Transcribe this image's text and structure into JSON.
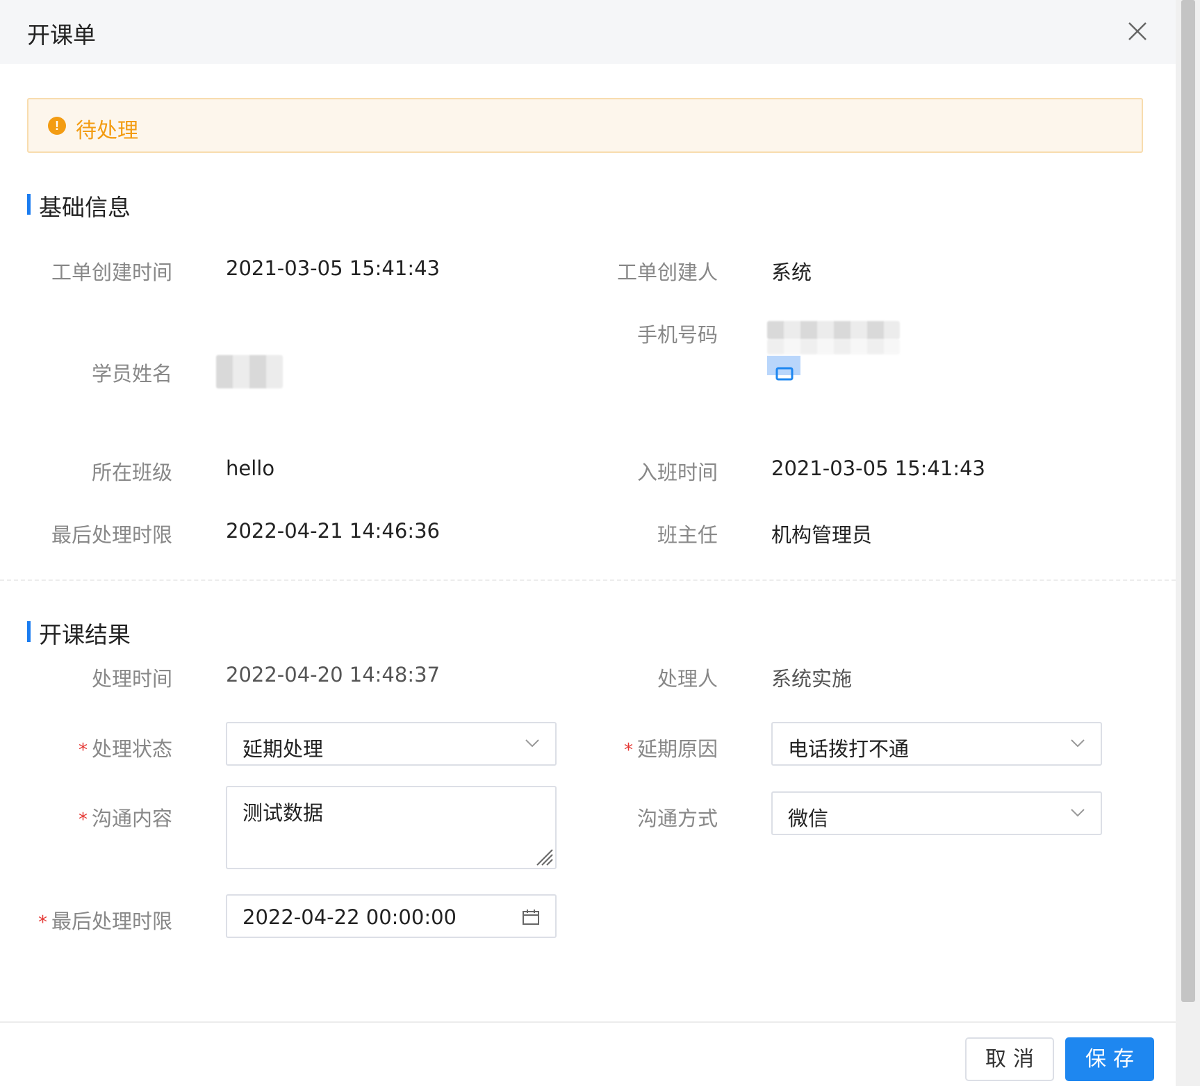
{
  "dialog": {
    "title": "开课单"
  },
  "status": {
    "text": "待处理",
    "icon": "exclamation-circle-icon",
    "color": "#f39c12"
  },
  "basic_info": {
    "section_title": "基础信息",
    "created_time_label": "工单创建时间",
    "created_time_value": "2021-03-05 15:41:43",
    "creator_label": "工单创建人",
    "creator_value": "系统",
    "student_name_label": "学员姓名",
    "phone_label": "手机号码",
    "class_label": "所在班级",
    "class_value": "hello",
    "join_time_label": "入班时间",
    "join_time_value": "2021-03-05 15:41:43",
    "deadline_label": "最后处理时限",
    "deadline_value": "2022-04-21 14:46:36",
    "head_teacher_label": "班主任",
    "head_teacher_value": "机构管理员"
  },
  "result": {
    "section_title": "开课结果",
    "process_time_label": "处理时间",
    "process_time_value": "2022-04-20 14:48:37",
    "processor_label": "处理人",
    "processor_value": "系统实施",
    "status_label": "处理状态",
    "status_value": "延期处理",
    "delay_reason_label": "延期原因",
    "delay_reason_value": "电话拨打不通",
    "content_label": "沟通内容",
    "content_value": "测试数据",
    "method_label": "沟通方式",
    "method_value": "微信",
    "deadline_label": "最后处理时限",
    "deadline_value": "2022-04-22 00:00:00",
    "required_mark": "*"
  },
  "footer": {
    "cancel_label": "取消",
    "save_label": "保存"
  },
  "colors": {
    "accent": "#1e87f0",
    "warning": "#f39c12",
    "required": "#e53935"
  }
}
